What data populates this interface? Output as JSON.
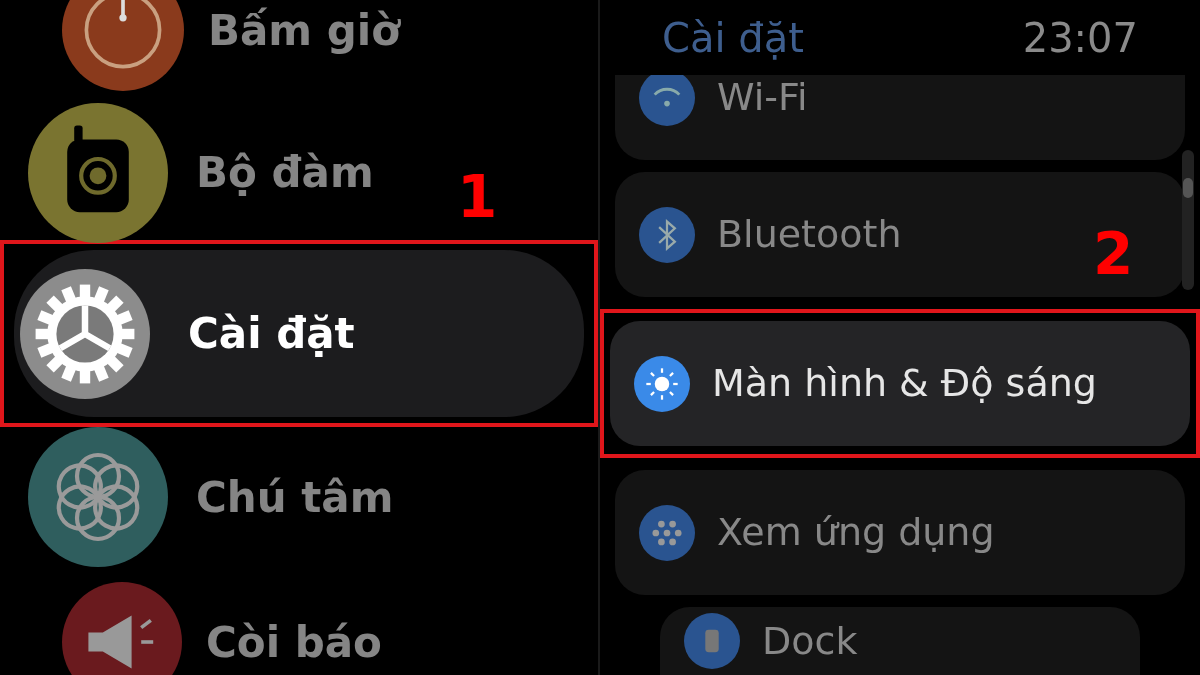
{
  "left_screen": {
    "apps": [
      {
        "name": "Bấm giờ",
        "selected": false
      },
      {
        "name": "Bộ đàm",
        "selected": false
      },
      {
        "name": "Cài đặt",
        "selected": true
      },
      {
        "name": "Chú tâm",
        "selected": false
      },
      {
        "name": "Còi báo",
        "selected": false
      }
    ]
  },
  "right_screen": {
    "title": "Cài đặt",
    "time": "23:07",
    "settings": [
      {
        "label": "Wi-Fi",
        "selected": false
      },
      {
        "label": "Bluetooth",
        "selected": false
      },
      {
        "label": "Màn hình & Độ sáng",
        "selected": true
      },
      {
        "label": "Xem ứng dụng",
        "selected": false
      },
      {
        "label": "Dock",
        "selected": false
      }
    ]
  },
  "annotations": [
    {
      "number": "1"
    },
    {
      "number": "2"
    }
  ]
}
